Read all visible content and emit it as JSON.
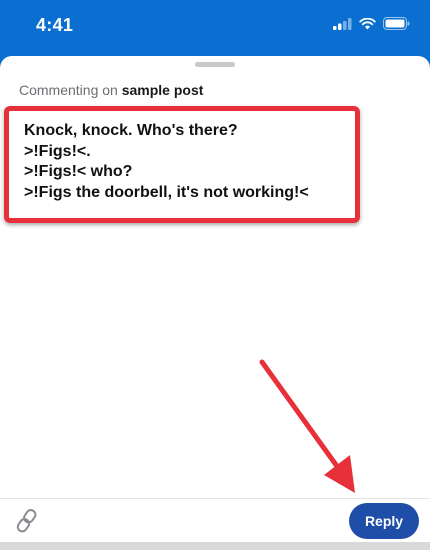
{
  "status_bar": {
    "time": "4:41"
  },
  "composer": {
    "commenting_prefix": "Commenting on",
    "post_title": "sample post",
    "comment_lines": [
      "Knock, knock. Who's there?",
      ">!Figs!<.",
      ">!Figs!< who?",
      ">!Figs the doorbell, it's not working!<"
    ]
  },
  "bottom_bar": {
    "link_icon": "link-icon",
    "reply_label": "Reply"
  },
  "colors": {
    "status_bar": "#0a6fd1",
    "highlight": "#e8303a",
    "reply_button": "#1f4ea8"
  }
}
